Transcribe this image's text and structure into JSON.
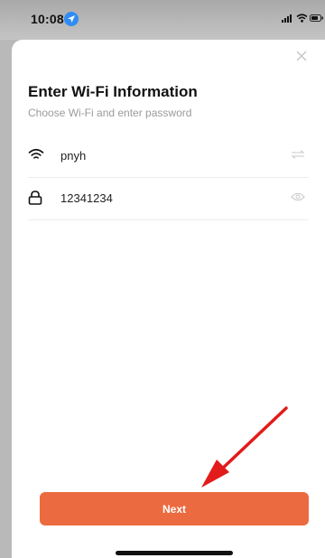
{
  "status_bar": {
    "time": "10:08"
  },
  "form": {
    "title": "Enter Wi-Fi Information",
    "subtitle": "Choose Wi-Fi and enter password",
    "wifi_name": "pnyh",
    "password": "12341234"
  },
  "actions": {
    "next_label": "Next"
  },
  "colors": {
    "primary": "#ec6a3f",
    "annotation_arrow": "#e21b1b",
    "location_badge": "#2f8cf5"
  },
  "icons": {
    "wifi": "wifi-icon",
    "lock": "lock-icon",
    "switch_network": "switch-arrows-icon",
    "show_password": "eye-icon",
    "close": "close-icon"
  }
}
